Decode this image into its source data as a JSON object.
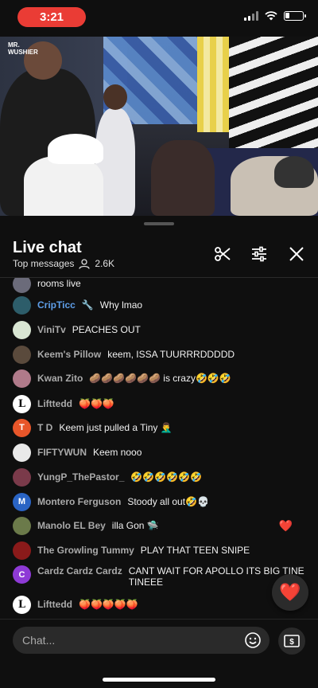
{
  "status_bar": {
    "time": "3:21"
  },
  "video": {
    "logo_line1": "MR.",
    "logo_line2": "WUSHIER"
  },
  "chat_header": {
    "title": "Live chat",
    "mode": "Top messages",
    "viewer_count": "2.6K"
  },
  "messages": [
    {
      "author": "",
      "text": "rooms live",
      "avatar_color": "#6b6b7a",
      "avatar_letter": ""
    },
    {
      "author": "CripTicc",
      "text": "Why lmao",
      "author_color": "blue",
      "badge": "wrench-icon",
      "avatar_color": "#2d5d6a",
      "avatar_letter": ""
    },
    {
      "author": "ViniTv",
      "text": "PEACHES OUT",
      "avatar_color": "#d9e6d3",
      "avatar_letter": ""
    },
    {
      "author": "Keem's Pillow",
      "text": "keem, ISSA TUURRRDDDDD",
      "avatar_color": "#5a4a3c",
      "avatar_letter": ""
    },
    {
      "author": "Kwan Zito",
      "text": "🥔🥔🥔🥔🥔🥔 is crazy🤣🤣🤣",
      "avatar_color": "#b07a8a",
      "avatar_letter": ""
    },
    {
      "author": "Lifttedd",
      "text": "🍑🍑🍑",
      "avatar_color": "#ffffff",
      "avatar_letter": "L"
    },
    {
      "author": "T D",
      "text": "Keem just pulled a Tiny 🤦‍♂️",
      "avatar_color": "#e8562a",
      "avatar_letter": "T"
    },
    {
      "author": "FIFTYWUN",
      "text": "Keem nooo",
      "avatar_color": "#e9e9e9",
      "avatar_letter": ""
    },
    {
      "author": "YungP_ThePastor_",
      "text": "🤣🤣🤣🤣🤣🤣",
      "avatar_color": "#7a3a4a",
      "avatar_letter": ""
    },
    {
      "author": "Montero Ferguson",
      "text": "Stoody all out🤣💀",
      "avatar_color": "#2a64c4",
      "avatar_letter": "M"
    },
    {
      "author": "Manolo EL Bey",
      "text": "illa Gon 🛸",
      "avatar_color": "#6b7a4a",
      "avatar_letter": "",
      "heart": "❤️"
    },
    {
      "author": "The Growling Tummy",
      "text": "PLAY THAT TEEN SNIPE",
      "avatar_color": "#8a1a1a",
      "avatar_letter": ""
    },
    {
      "author": "Cardz Cardz Cardz",
      "text": "CANT WAIT FOR APOLLO ITS BIG TINE TINEEE",
      "avatar_color": "#8e3ad6",
      "avatar_letter": "C"
    },
    {
      "author": "Lifttedd",
      "text": "🍑🍑🍑🍑🍑",
      "avatar_color": "#ffffff",
      "avatar_letter": "L"
    }
  ],
  "input": {
    "placeholder": "Chat..."
  },
  "colors": {
    "accent_blue": "#5e9ee8",
    "like_red": "#e8233a",
    "status_red": "#ea3c35"
  }
}
